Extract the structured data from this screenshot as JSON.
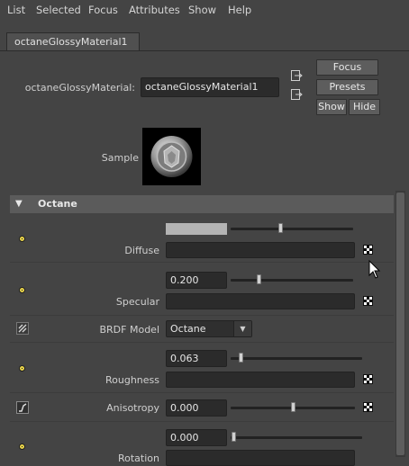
{
  "menubar": {
    "items": [
      "List",
      "Selected",
      "Focus",
      "Attributes",
      "Show",
      "Help"
    ]
  },
  "tab": {
    "label": "octaneGlossyMaterial1"
  },
  "header": {
    "node_label": "octaneGlossyMaterial:",
    "node_value": "octaneGlossyMaterial1",
    "focus_label": "Focus",
    "presets_label": "Presets",
    "show_label": "Show",
    "hide_label": "Hide",
    "sample_label": "Sample"
  },
  "section": {
    "title": "Octane"
  },
  "attributes": {
    "diffuse": {
      "label": "Diffuse",
      "swatch_color": "#b4b4b4",
      "slider_fraction": 0.45
    },
    "specular": {
      "label": "Specular",
      "value": "0.200",
      "slider_fraction": 0.2
    },
    "brdf": {
      "label": "BRDF Model",
      "value": "Octane"
    },
    "roughness": {
      "label": "Roughness",
      "value": "0.063",
      "slider_fraction": 0.063
    },
    "anisotropy": {
      "label": "Anisotropy",
      "value": "0.000",
      "slider_fraction": 0.5
    },
    "rotation": {
      "label": "Rotation",
      "value": "0.000",
      "slider_fraction": 0.0
    }
  },
  "colors": {
    "background": "#444444",
    "field": "#2b2b2b",
    "connect_dot": "#e8d34a",
    "section_header": "#5b5b5b"
  }
}
